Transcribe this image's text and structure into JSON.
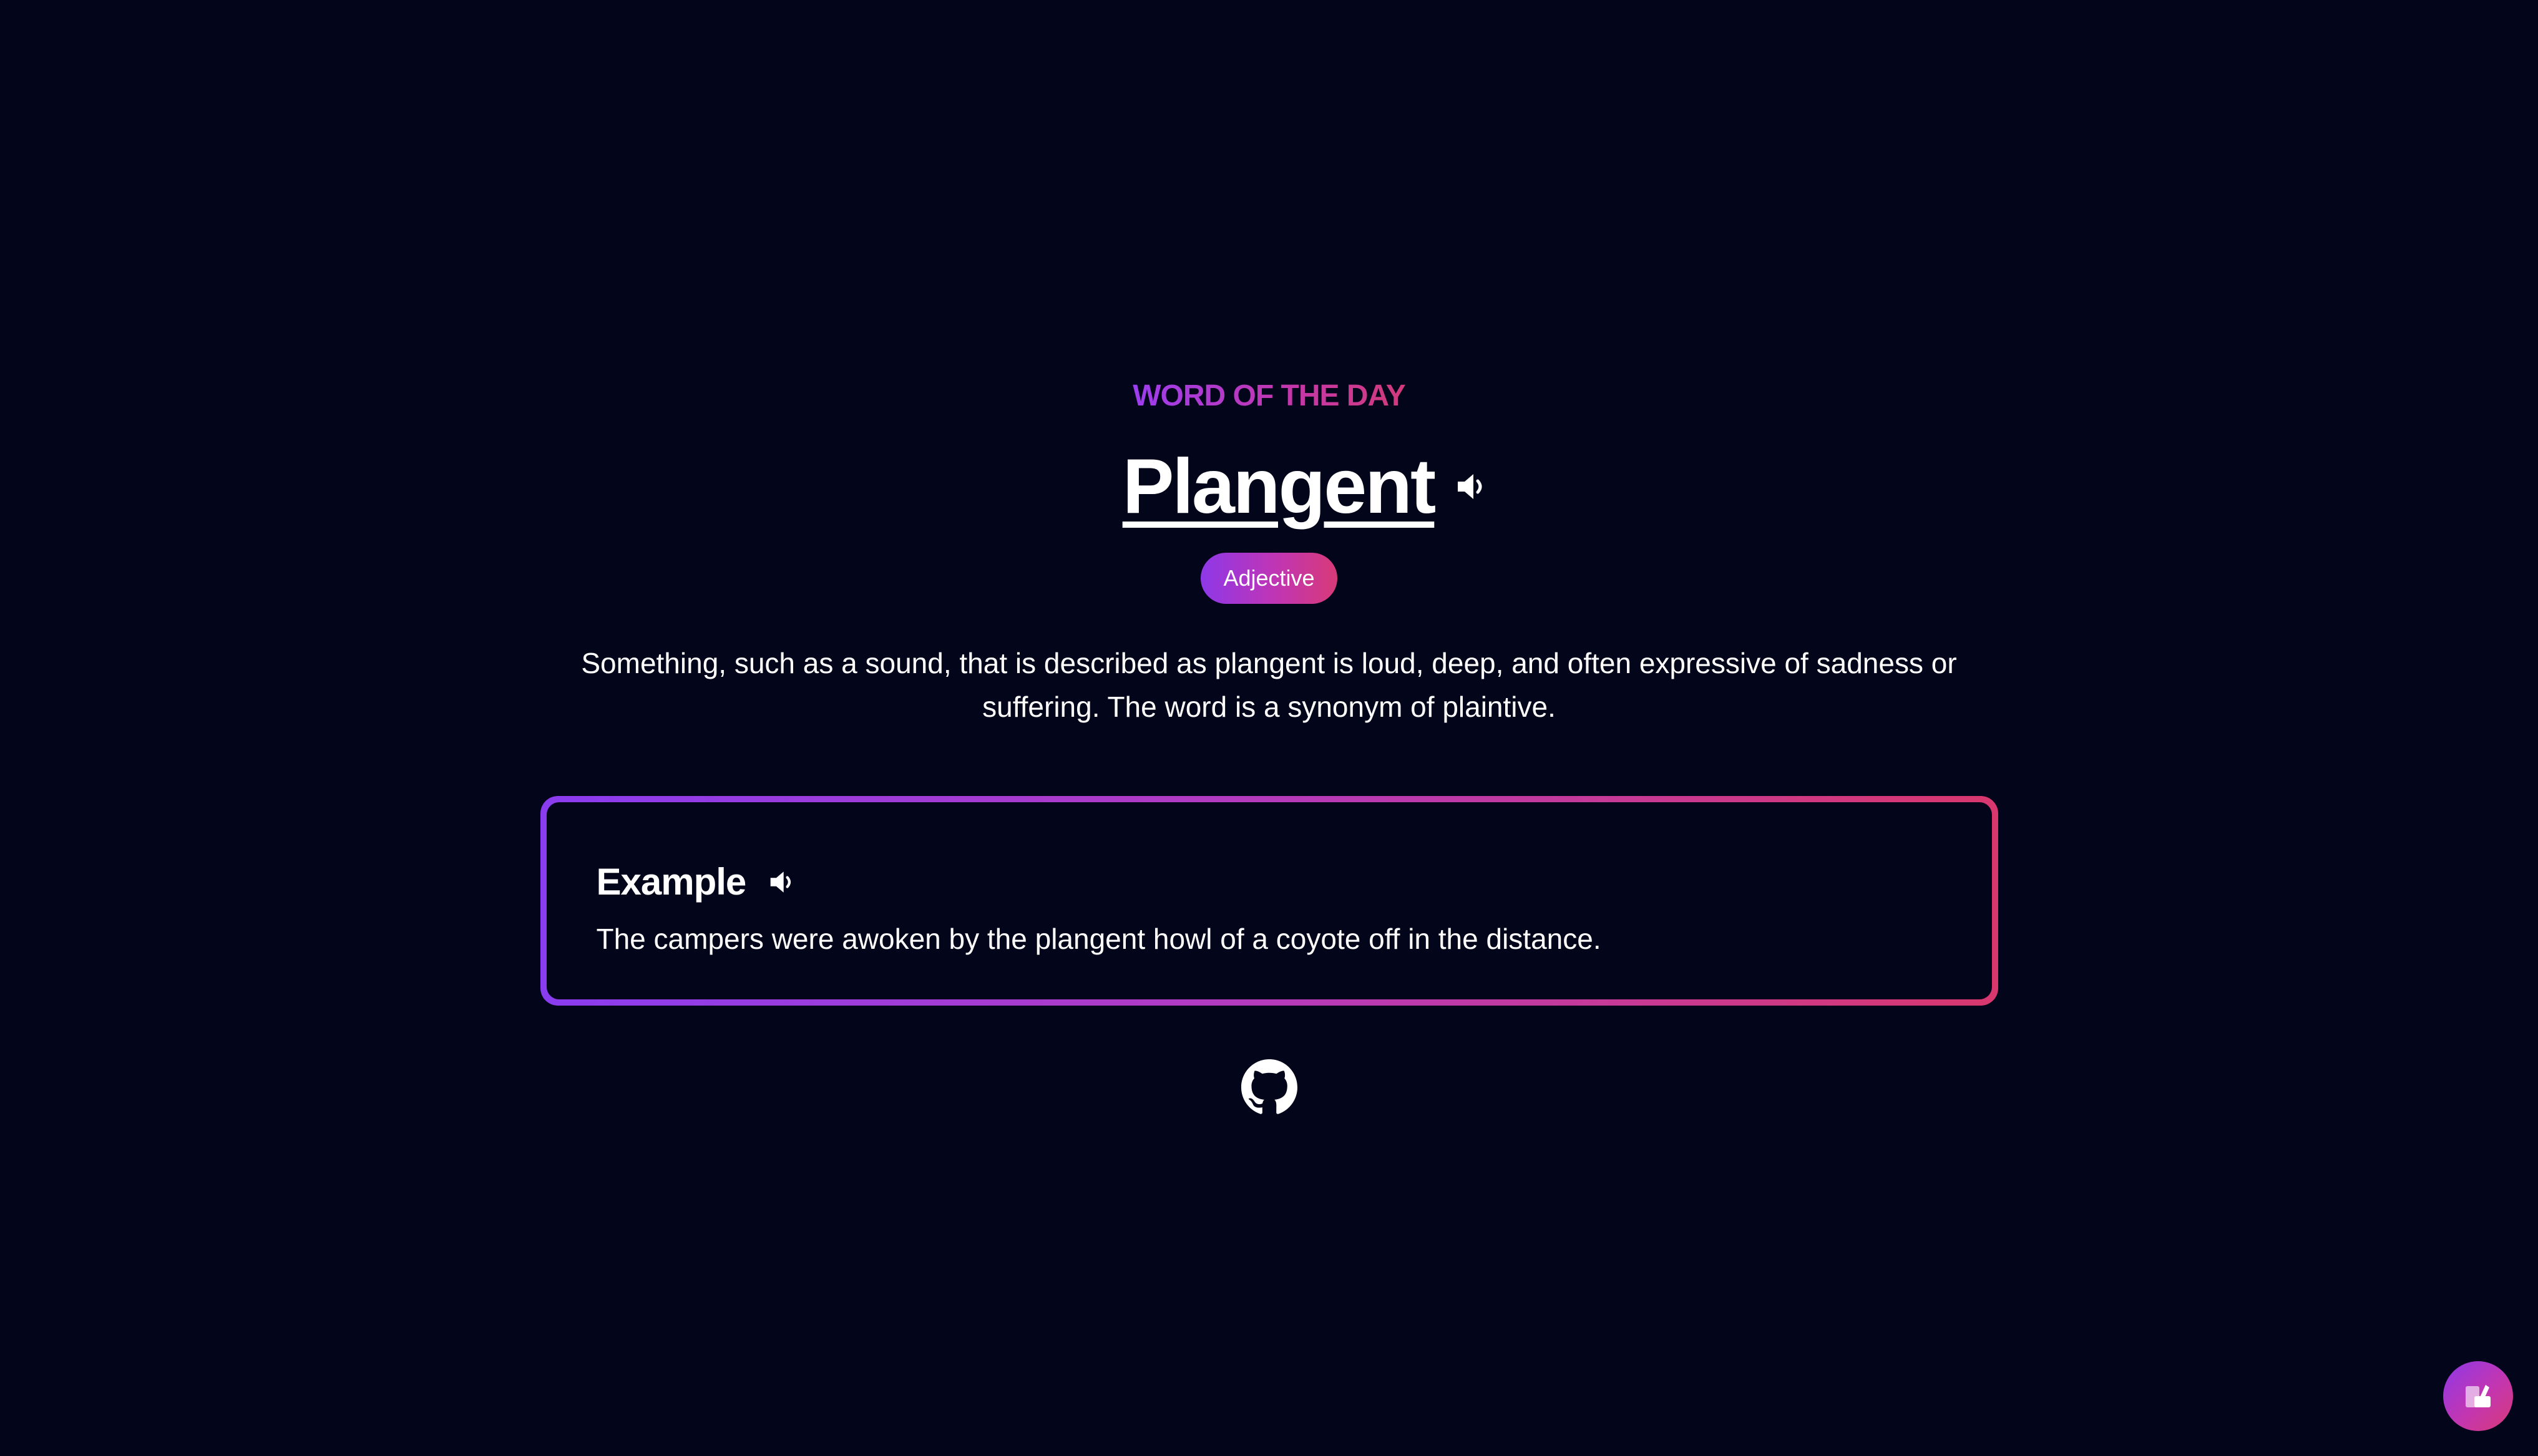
{
  "header": {
    "eyebrow": "WORD OF THE DAY"
  },
  "word": {
    "text": "Plangent",
    "part_of_speech": "Adjective",
    "speaker_icon": "speaker-icon",
    "definition": "Something, such as a sound, that is described as plangent is loud, deep, and often expressive of sadness or suffering. The word is a synonym of plaintive."
  },
  "example": {
    "title": "Example",
    "speaker_icon": "speaker-icon",
    "sentence": "The campers were awoken by the plangent howl of a coyote off in the distance."
  },
  "footer": {
    "github_icon": "github-icon"
  },
  "floating_button": {
    "icon": "app-logo-icon"
  },
  "colors": {
    "background": "#03061a",
    "gradient_start": "#9d3df0",
    "gradient_end": "#d9386e",
    "text": "#ffffff"
  }
}
